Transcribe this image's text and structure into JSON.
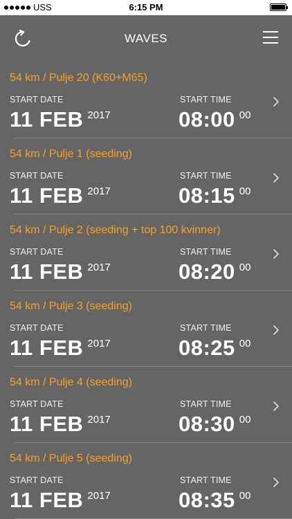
{
  "status_bar": {
    "carrier": "USS",
    "time": "6:15 PM"
  },
  "nav": {
    "title": "WAVES",
    "left_icon": "refresh-icon",
    "right_icon": "menu-icon"
  },
  "colors": {
    "background": "#656565",
    "accent": "#f5a02a",
    "text": "#ffffff"
  },
  "labels": {
    "start_date": "START DATE",
    "start_time": "START TIME"
  },
  "waves": [
    {
      "name": "54 km / Pulje 20 (K60+M65)",
      "date": "11 FEB",
      "year": "2017",
      "time": "08:00",
      "sec": "00"
    },
    {
      "name": "54 km / Pulje 1 (seeding)",
      "date": "11 FEB",
      "year": "2017",
      "time": "08:15",
      "sec": "00"
    },
    {
      "name": "54 km / Pulje 2 (seeding + top 100 kvinner)",
      "date": "11 FEB",
      "year": "2017",
      "time": "08:20",
      "sec": "00"
    },
    {
      "name": "54 km / Pulje 3 (seeding)",
      "date": "11 FEB",
      "year": "2017",
      "time": "08:25",
      "sec": "00"
    },
    {
      "name": "54 km / Pulje 4 (seeding)",
      "date": "11 FEB",
      "year": "2017",
      "time": "08:30",
      "sec": "00"
    },
    {
      "name": "54 km / Pulje 5 (seeding)",
      "date": "11 FEB",
      "year": "2017",
      "time": "08:35",
      "sec": "00"
    }
  ]
}
